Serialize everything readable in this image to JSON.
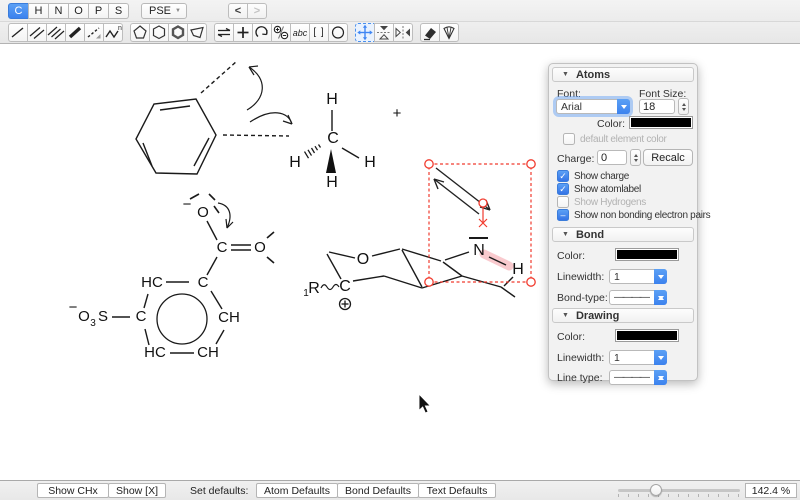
{
  "colors": {
    "accent_blue": "#4596f2",
    "selection_red": "#f13b2e",
    "highlight_pink": "rgba(236,95,105,0.33)",
    "swatch_black": "#000000"
  },
  "icons": {
    "disclosure_triangle": "▼",
    "dropdown_caret": "▼",
    "check_mark": "✓",
    "mixed_mark": "–"
  },
  "toolbar": {
    "elements": [
      {
        "label": "C",
        "state": "selected"
      },
      {
        "label": "H",
        "state": "normal"
      },
      {
        "label": "N",
        "state": "normal"
      },
      {
        "label": "O",
        "state": "normal"
      },
      {
        "label": "P",
        "state": "normal"
      },
      {
        "label": "S",
        "state": "normal"
      }
    ],
    "pse_label": "PSE",
    "back_label": "<",
    "forward_label": ">",
    "text_tool_label": "abc",
    "bracket_tool_label": "[ ]",
    "polymer_n_label": "n"
  },
  "panel": {
    "atoms": {
      "title": "Atoms",
      "font_label": "Font:",
      "font_value": "Arial",
      "font_size_label": "Font Size:",
      "font_size_value": "18",
      "color_label": "Color:",
      "default_element_color_label": "default element color",
      "charge_label": "Charge:",
      "charge_value": "0",
      "recalc_label": "Recalc",
      "checkboxes": [
        {
          "label": "Show charge",
          "state": "checked"
        },
        {
          "label": "Show atomlabel",
          "state": "checked"
        },
        {
          "label": "Show Hydrogens",
          "state": "unchecked"
        },
        {
          "label": "Show non bonding electron pairs",
          "state": "mixed"
        }
      ]
    },
    "bond": {
      "title": "Bond",
      "color_label": "Color:",
      "linewidth_label": "Linewidth:",
      "linewidth_value": "1",
      "bond_type_label": "Bond-type:",
      "bond_type_value": "————"
    },
    "drawing": {
      "title": "Drawing",
      "color_label": "Color:",
      "linewidth_label": "Linewidth:",
      "linewidth_value": "1",
      "line_type_label": "Line type:",
      "line_type_value": "————"
    }
  },
  "statusbar": {
    "show_chx_label": "Show CHx",
    "show_x_label": "Show [X]",
    "set_defaults_label": "Set defaults:",
    "atom_defaults_label": "Atom Defaults",
    "bond_defaults_label": "Bond Defaults",
    "text_defaults_label": "Text Defaults",
    "zoom_value": "142.4 %"
  },
  "canvas": {
    "plus_sign": "+",
    "methane": {
      "center": "C",
      "h_top": "H",
      "h_left": "H",
      "h_right": "H",
      "h_bottom": "H"
    },
    "benzoate": {
      "o_top": "O",
      "o_top_charge": "−",
      "carboxyl_c": "C",
      "o_right": "O",
      "ring_hc_topleft": "HC",
      "ring_c_topright": "C",
      "ring_ch_right": "CH",
      "ring_ch_bottomright": "CH",
      "ring_hc_bottomleft": "HC",
      "ring_c_left": "C",
      "so3_charge": "−",
      "so3_o": "O",
      "so3_sub": "3",
      "so3_s": "S"
    },
    "chair": {
      "o": "O",
      "n": "N",
      "h": "H",
      "c": "C",
      "r_sub": "1",
      "r_label": "R"
    }
  }
}
